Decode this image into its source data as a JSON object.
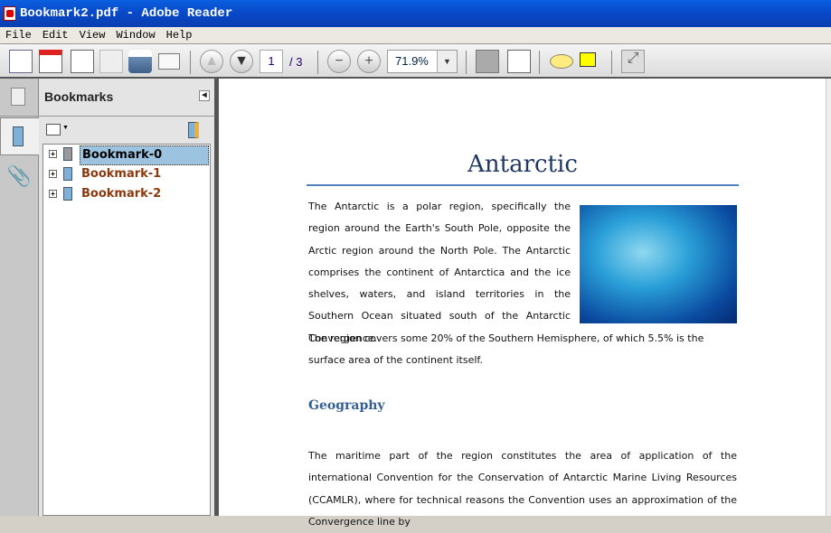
{
  "window": {
    "title": "Bookmark2.pdf - Adobe Reader"
  },
  "menu": [
    "File",
    "Edit",
    "View",
    "Window",
    "Help"
  ],
  "toolbar": {
    "page_current": "1",
    "page_total": "/ 3",
    "zoom": "71.9%"
  },
  "panel": {
    "title": "Bookmarks",
    "bookmarks": [
      {
        "label": "Bookmark-0",
        "selected": true
      },
      {
        "label": "Bookmark-1"
      },
      {
        "label": "Bookmark-2"
      }
    ]
  },
  "document": {
    "title": "Antarctic",
    "intro_wrapped": "The Antarctic is a polar region, specifically the region around the Earth's South Pole, opposite the Arctic region around the North Pole. The Antarctic comprises the continent of Antarctica and the ice shelves, waters, and island territories in the Southern Ocean situated south of the Antarctic Convergence.",
    "intro_full": "The region covers some 20% of the Southern Hemisphere, of which 5.5% is the surface area of the continent itself.",
    "heading": "Geography",
    "para2": "The maritime part of the region constitutes the area of application of the international Convention for the Conservation of Antarctic Marine Living Resources (CCAMLR), where for technical reasons the Convention uses an approximation of the Convergence line by"
  }
}
